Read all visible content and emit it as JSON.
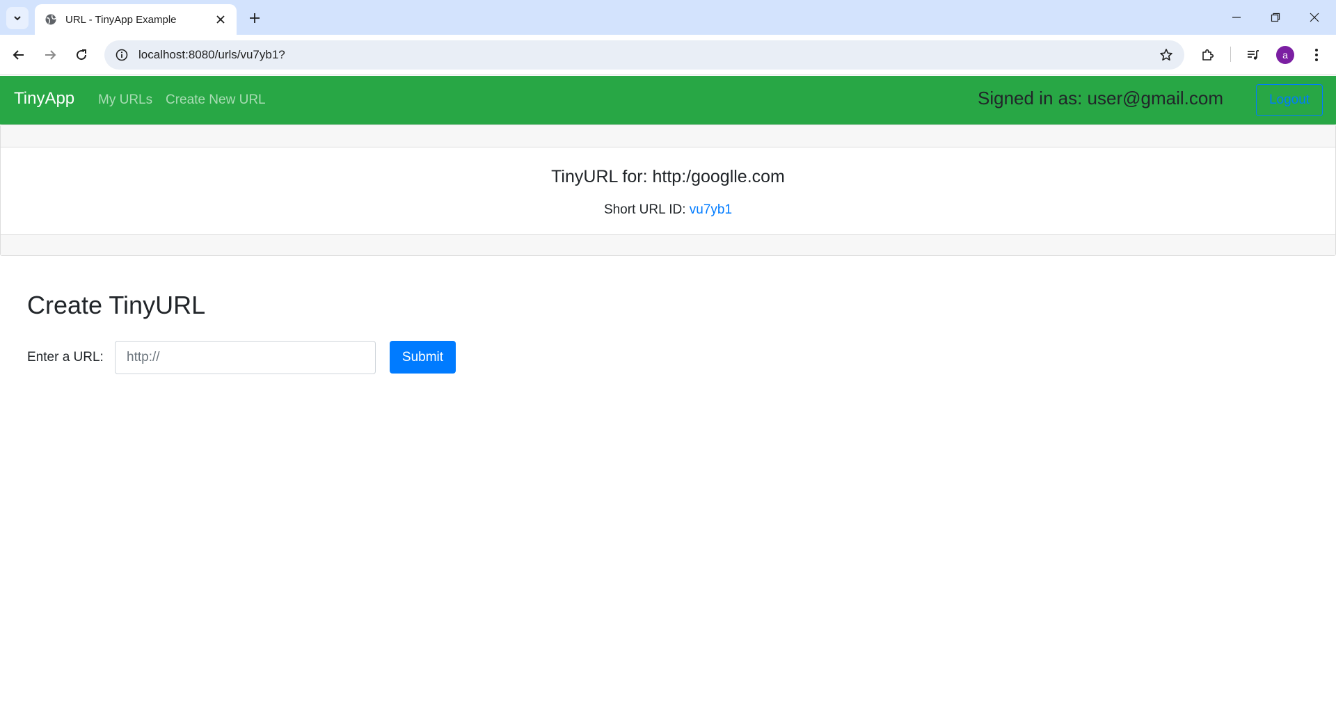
{
  "browser": {
    "tab_title": "URL - TinyApp Example",
    "address": "localhost:8080/urls/vu7yb1?",
    "profile_initial": "a"
  },
  "navbar": {
    "brand": "TinyApp",
    "links": [
      "My URLs",
      "Create New URL"
    ],
    "signed_in": "Signed in as: user@gmail.com",
    "logout": "Logout"
  },
  "card": {
    "title": "TinyURL for: http:/googlle.com",
    "short_label": "Short URL ID: ",
    "short_id": "vu7yb1"
  },
  "form": {
    "heading": "Create TinyURL",
    "label": "Enter a URL:",
    "placeholder": "http://",
    "submit": "Submit"
  },
  "colors": {
    "navbar": "#28a745",
    "primary": "#007bff",
    "tabstrip": "#d3e3fd"
  }
}
